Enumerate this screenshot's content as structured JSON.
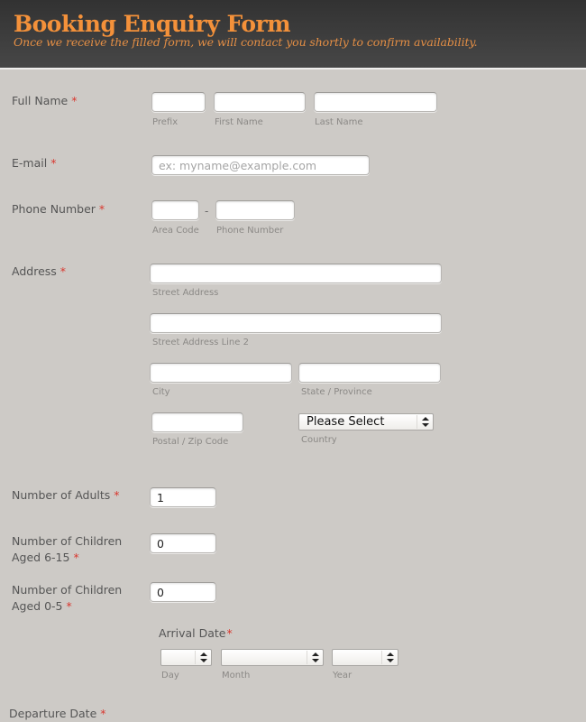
{
  "header": {
    "title": "Booking Enquiry Form",
    "subtitle": "Once we receive the filled form, we will contact you shortly to confirm availability."
  },
  "required_mark": "*",
  "full_name": {
    "label": "Full Name",
    "prefix": {
      "value": "",
      "sublabel": "Prefix"
    },
    "first": {
      "value": "",
      "sublabel": "First Name"
    },
    "last": {
      "value": "",
      "sublabel": "Last Name"
    }
  },
  "email": {
    "label": "E-mail",
    "value": "",
    "placeholder": "ex: myname@example.com"
  },
  "phone": {
    "label": "Phone Number",
    "separator": "-",
    "area_code": {
      "value": "",
      "sublabel": "Area Code"
    },
    "number": {
      "value": "",
      "sublabel": "Phone Number"
    }
  },
  "address": {
    "label": "Address",
    "street": {
      "value": "",
      "sublabel": "Street Address"
    },
    "street2": {
      "value": "",
      "sublabel": "Street Address Line 2"
    },
    "city": {
      "value": "",
      "sublabel": "City"
    },
    "state": {
      "value": "",
      "sublabel": "State / Province"
    },
    "postal": {
      "value": "",
      "sublabel": "Postal / Zip Code"
    },
    "country": {
      "selected": "Please Select",
      "sublabel": "Country"
    }
  },
  "adults": {
    "label": "Number of Adults",
    "value": "1"
  },
  "children_6_15": {
    "label_line1": "Number of Children",
    "label_line2": "Aged 6-15",
    "value": "0"
  },
  "children_0_5": {
    "label_line1": "Number of Children",
    "label_line2": "Aged 0-5",
    "value": "0"
  },
  "arrival": {
    "label": "Arrival Date",
    "day": {
      "selected": "",
      "sublabel": "Day"
    },
    "month": {
      "selected": "",
      "sublabel": "Month"
    },
    "year": {
      "selected": "",
      "sublabel": "Year"
    }
  },
  "departure": {
    "label": "Departure Date"
  }
}
